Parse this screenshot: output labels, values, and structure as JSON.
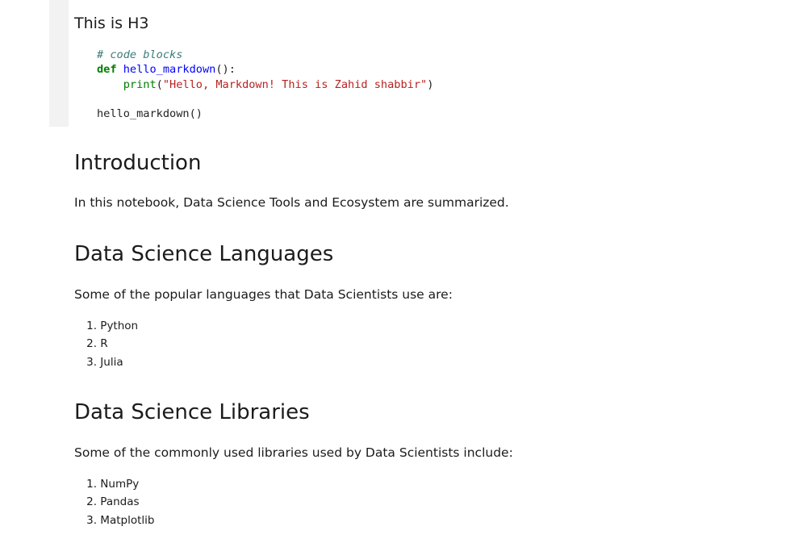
{
  "cell_top": {
    "heading": "This is H3",
    "code": {
      "comment": "# code blocks",
      "def_kw": "def",
      "fn_name": "hello_markdown",
      "fn_parens": "():",
      "print_fn": "print",
      "open_paren": "(",
      "string": "\"Hello, Markdown! This is Zahid shabbir\"",
      "close_paren": ")",
      "call": "hello_markdown()"
    }
  },
  "intro": {
    "heading": "Introduction",
    "text": "In this notebook, Data Science Tools and Ecosystem are summarized."
  },
  "languages": {
    "heading": "Data Science Languages",
    "text": "Some of the popular languages that Data Scientists use are:",
    "items": [
      {
        "num": "1.",
        "label": "Python"
      },
      {
        "num": "2.",
        "label": "R"
      },
      {
        "num": "3.",
        "label": "Julia"
      }
    ]
  },
  "libraries": {
    "heading": "Data Science Libraries",
    "text": "Some of the commonly used libraries used by Data Scientists include:",
    "items": [
      {
        "num": "1.",
        "label": "NumPy"
      },
      {
        "num": "2.",
        "label": "Pandas"
      },
      {
        "num": "3.",
        "label": "Matplotlib"
      }
    ]
  }
}
